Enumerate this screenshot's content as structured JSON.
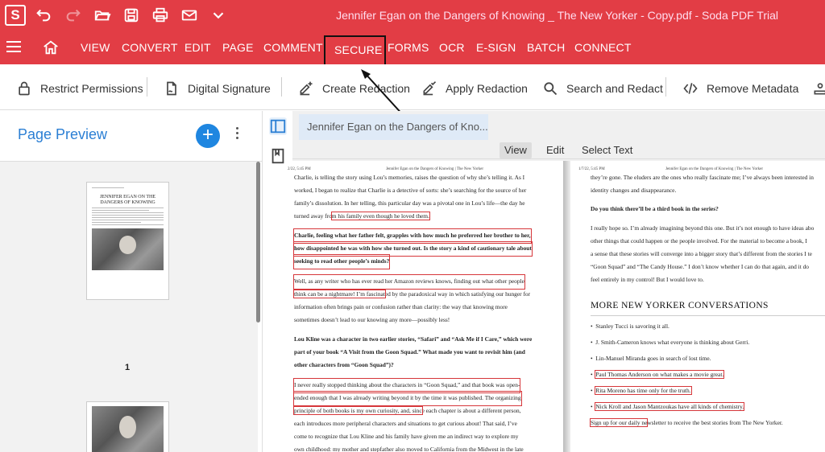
{
  "app": {
    "logo": "S",
    "window_title": "Jennifer Egan on the Dangers of Knowing _ The New Yorker - Copy.pdf   -   Soda PDF Trial"
  },
  "titlebar_icons": [
    "undo-icon",
    "redo-icon",
    "open-folder-icon",
    "save-icon",
    "print-icon",
    "email-icon",
    "chevron-down-icon"
  ],
  "menu": {
    "items": [
      "VIEW",
      "CONVERT",
      "EDIT",
      "PAGE",
      "COMMENT",
      "SECURE",
      "FORMS",
      "OCR",
      "E-SIGN",
      "BATCH",
      "CONNECT"
    ],
    "active": "SECURE"
  },
  "toolbar": {
    "restrict": "Restrict Permissions",
    "digital_signature": "Digital Signature",
    "create_redaction": "Create Redaction",
    "apply_redaction": "Apply Redaction",
    "search_redact": "Search and Redact",
    "remove_metadata": "Remove Metadata"
  },
  "left_panel": {
    "title": "Page Preview",
    "add_label": "+",
    "thumb1_title": "JENNIFER EGAN ON THE DANGERS OF KNOWING",
    "page1_number": "1"
  },
  "document": {
    "tab_title": "Jennifer Egan on the Dangers of Kno...",
    "view_modes": [
      "View",
      "Edit",
      "Select Text"
    ],
    "active_mode": "View",
    "header_left": "2/22, 5:45 PM",
    "header_center": "Jennifer Egan on the Dangers of Knowing | The New Yorker",
    "page2_header_left": "1/7/22, 5:45 PM"
  },
  "page1": {
    "l1": "Charlie, is telling the story using Lou’s memories, raises the question of why she’s telling it. As I",
    "l2": "worked, I began to realize that Charlie is a detective of sorts: she’s searching for the source of her",
    "l3": "family’s dissolution. In her telling, this particular day was a pivotal one in Lou’s life—the day he",
    "l4a": "turned away fro",
    "l4b": "m his family even though he loved them.",
    "q1a": "Charlie, feeling what her father felt, grapples with how much he preferred her brother to her,",
    "q1b": "how disappointed he was with how she turned out. Is the story a kind of cautionary tale about",
    "q1c": "seeking to read other people’s minds?",
    "a2a": "Well, as any writer who has ever read her Amazon reviews knows, finding out what other people",
    "a2b": "think can be a nightmare! I’m fascinat",
    "a2b2": "ed by the paradoxical way in which satisfying our hunger for",
    "a2c": "information often brings pain or confusion rather than clarity: the way that knowing more",
    "a2d": "sometimes doesn’t lead to our knowing any more—possibly less!",
    "q2a": "Lou Kline was a character in two earlier stories, “Safari” and “Ask Me if I Care,” which were",
    "q2b": "part of your book “A Visit from the Goon Squad.” What made you want to revisit him (and",
    "q2c": "other characters from “Goon Squad”)?",
    "a3a": "I never really stopped thinking about the characters in “Goon Squad,” and that book was open-",
    "a3b": "ended enough that I was already writing beyond it by the time it was published. The organizing",
    "a3c": "principle of both books is my own curiosity, and, sinc",
    "a3c2": "e each chapter is about a different person,",
    "a3d": "each introduces more peripheral characters and situations to get curious about! That said, I’ve",
    "a3e": "come to recognize that Lou Kline and his family have given me an indirect way to explore my",
    "a3f": "own childhood: my mother and stepfather also moved to California from the Midwest in the late",
    "a3g": "sixties with my little brother and me, and our family did eventually dissolve."
  },
  "page2": {
    "l1": "they’re gone. The eluders are the ones who really fascinate me; I’ve always been interested in",
    "l2": "identity changes and disappearance.",
    "q": "Do you think there’ll be a third book in the series?",
    "a1": "I really hope so. I’m already imagining beyond this one. But it’s not enough to have ideas abo",
    "a2": "other things that could happen or the people involved. For the material to become a book, I",
    "a3": "a sense that these stories will converge into a bigger story that’s different from the stories I te",
    "a4": "“Goon Squad” and “The Candy House.” I don’t know whether I can do that again, and it do",
    "a5": "feel entirely in my control! But I would love to.",
    "section": "MORE NEW YORKER CONVERSATIONS",
    "b1": "Stanley Tucci is savoring it all.",
    "b2": "J. Smith-Cameron knows what everyone is thinking about Gerri.",
    "b3": "Lin-Manuel Miranda goes in search of lost time.",
    "b4": "Paul Thomas Anderson on what makes a movie great.",
    "b5": "Rita Moreno has time only for the truth.",
    "b6": "Nick Kroll and Jason Mantzoukas have all kinds of chemistry.",
    "s1": "Sign up for our daily ne",
    "s2": "wsletter to receive the best stories from The New Yorker."
  }
}
